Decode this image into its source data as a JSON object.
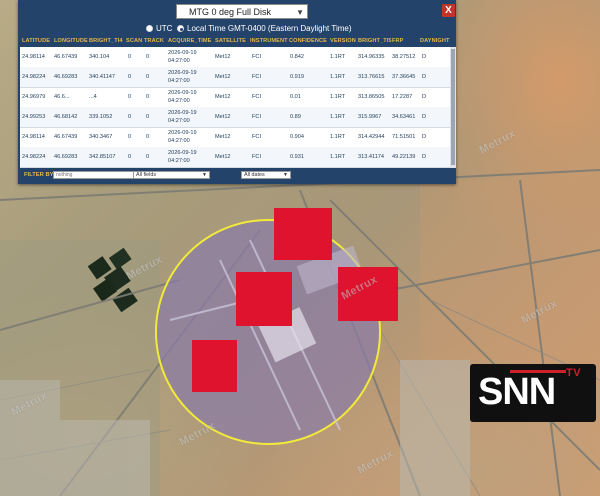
{
  "source_select": {
    "value": "MTG 0 deg Full Disk"
  },
  "close_label": "X",
  "timezone": {
    "utc_label": "UTC",
    "local_label": "Local Time GMT-0400 (Eastern Daylight Time)",
    "selected": "local"
  },
  "table": {
    "columns": [
      "LATITUDE",
      "LONGITUDE",
      "BRIGHT_TI4",
      "SCAN",
      "TRACK",
      "ACQUIRE_TIME",
      "SATELLITE",
      "INSTRUMENT",
      "CONFIDENCE",
      "VERSION",
      "BRIGHT_TI5",
      "FRP",
      "DAYNIGHT"
    ],
    "rows": [
      {
        "lat": "24.98114",
        "lon": "46.67439",
        "bt4": "340.104",
        "scan": "0",
        "track": "0",
        "date": "2026-09-19",
        "time": "04:27:00",
        "sat": "Met12",
        "inst": "FCI",
        "conf": "0.842",
        "ver": "1.1RT",
        "bt5": "314.96335",
        "frp": "38.27512",
        "dn": "D"
      },
      {
        "lat": "24.98224",
        "lon": "46.69283",
        "bt4": "340.41147",
        "scan": "0",
        "track": "0",
        "date": "2026-09-19",
        "time": "04:27:00",
        "sat": "Met12",
        "inst": "FCI",
        "conf": "0.919",
        "ver": "1.1RT",
        "bt5": "313.76615",
        "frp": "37.36645",
        "dn": "D"
      },
      {
        "lat": "24.96979",
        "lon": "46.6...",
        "bt4": "...4",
        "scan": "0",
        "track": "0",
        "date": "2026-09-19",
        "time": "04:27:00",
        "sat": "Met12",
        "inst": "FCI",
        "conf": "0.01",
        "ver": "1.1RT",
        "bt5": "313.86505",
        "frp": "17.2287",
        "dn": "D"
      },
      {
        "lat": "24.99253",
        "lon": "46.68142",
        "bt4": "339.1052",
        "scan": "0",
        "track": "0",
        "date": "2026-09-19",
        "time": "04:27:00",
        "sat": "Met12",
        "inst": "FCI",
        "conf": "0.89",
        "ver": "1.1RT",
        "bt5": "315.9967",
        "frp": "34.63461",
        "dn": "D"
      },
      {
        "lat": "24.98114",
        "lon": "46.67439",
        "bt4": "340.3467",
        "scan": "0",
        "track": "0",
        "date": "2026-09-19",
        "time": "04:27:00",
        "sat": "Met12",
        "inst": "FCI",
        "conf": "0.904",
        "ver": "1.1RT",
        "bt5": "314.42944",
        "frp": "71.51501",
        "dn": "D"
      },
      {
        "lat": "24.98224",
        "lon": "46.69283",
        "bt4": "342.85107",
        "scan": "0",
        "track": "0",
        "date": "2026-09-19",
        "time": "04:27:00",
        "sat": "Met12",
        "inst": "FCI",
        "conf": "0.931",
        "ver": "1.1RT",
        "bt5": "313.41174",
        "frp": "49.22139",
        "dn": "D"
      }
    ]
  },
  "filter": {
    "label": "FILTER BY",
    "placeholder": "nothing",
    "field_value": "All fields",
    "date_value": "All dates"
  },
  "watermark": "Metrux",
  "logo": {
    "text": "SNN",
    "tv": "TV"
  },
  "colors": {
    "panel": "#24436a",
    "header_text": "#e7b64a",
    "hotspot": "#e0132e",
    "circle_stroke": "#f2ea3a",
    "logo_red": "#d0202a"
  }
}
